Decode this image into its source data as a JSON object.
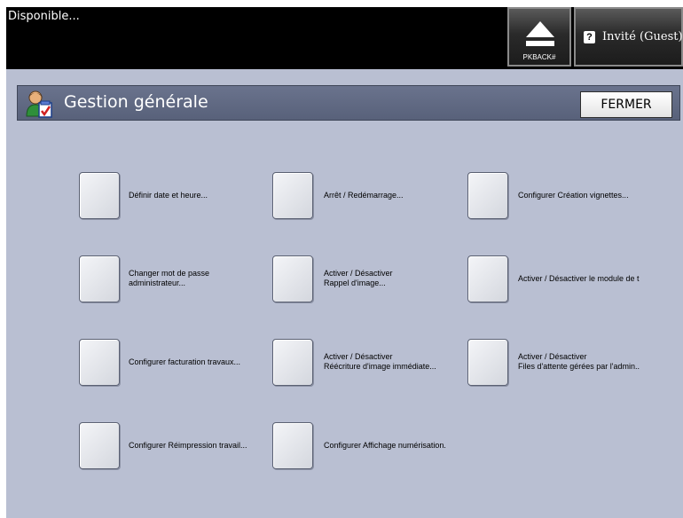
{
  "status_text": "Disponible...",
  "pkback": {
    "label": "PKBACK#",
    "icon": "eject-icon"
  },
  "guest": {
    "icon": "help-icon",
    "label": "Invité (Guest)",
    "help_glyph": "?"
  },
  "header": {
    "title": "Gestion générale",
    "icon": "user-checklist-icon",
    "close_label": "FERMER"
  },
  "colors": {
    "screen_bg": "#b9bfd2",
    "topbar_bg": "#000000",
    "titlebar_bg": "#5f6882"
  },
  "options": [
    {
      "id": "date-time",
      "line1": "Définir date et heure...",
      "line2": ""
    },
    {
      "id": "restart",
      "line1": "Arrêt / Redémarrage...",
      "line2": ""
    },
    {
      "id": "thumbnail-config",
      "line1": "Configurer Création vignettes...",
      "line2": ""
    },
    {
      "id": "admin-password",
      "line1": "Changer mot de passe",
      "line2": "administrateur..."
    },
    {
      "id": "image-recall",
      "line1": "Activer / Désactiver",
      "line2": "Rappel d'image..."
    },
    {
      "id": "module-toggle",
      "line1": "Activer / Désactiver le module de t",
      "line2": ""
    },
    {
      "id": "job-billing",
      "line1": "Configurer facturation travaux...",
      "line2": ""
    },
    {
      "id": "immediate-overwrite",
      "line1": "Activer / Désactiver",
      "line2": "Réécriture d'image immédiate..."
    },
    {
      "id": "admin-queues",
      "line1": "Activer / Désactiver",
      "line2": "Files d'attente gérées par l'admin.."
    },
    {
      "id": "job-reprint",
      "line1": "Configurer Réimpression travail...",
      "line2": ""
    },
    {
      "id": "scan-display",
      "line1": "Configurer Affichage numérisation.",
      "line2": ""
    }
  ]
}
